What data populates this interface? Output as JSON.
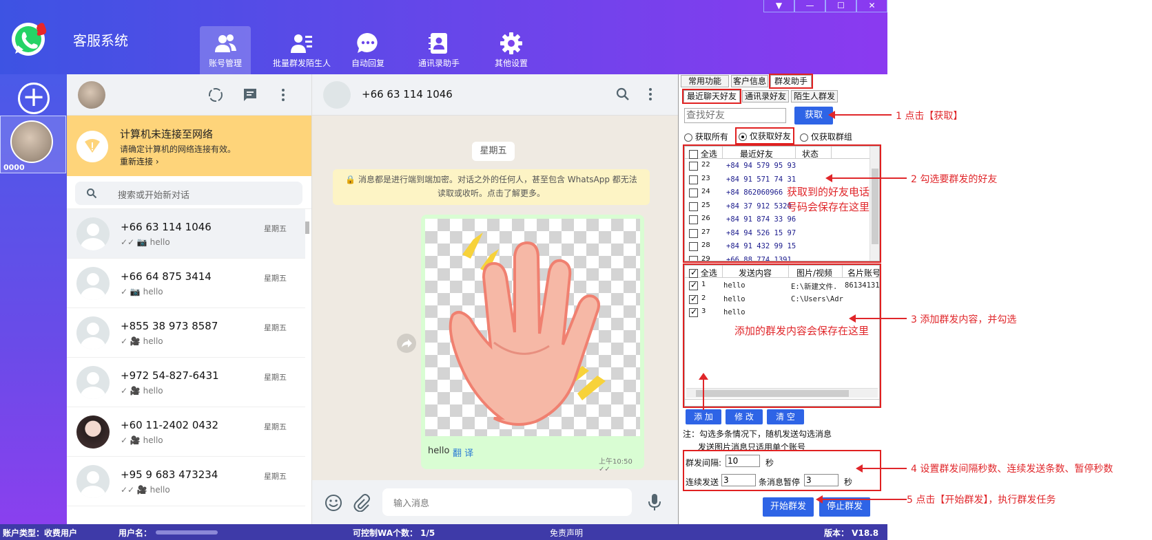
{
  "app": {
    "title": "客服系统"
  },
  "nav": [
    {
      "label": "账号管理",
      "icon": "users-icon"
    },
    {
      "label": "批量群发陌生人",
      "icon": "user-list-icon"
    },
    {
      "label": "自动回复",
      "icon": "chat-bubble-icon"
    },
    {
      "label": "通讯录助手",
      "icon": "contact-book-icon"
    },
    {
      "label": "其他设置",
      "icon": "gear-icon"
    }
  ],
  "window_controls": [
    "▼",
    "—",
    "☐",
    "✕"
  ],
  "account": {
    "label": "0000"
  },
  "network_warning": {
    "title": "计算机未连接至网络",
    "desc": "请确定计算机的网络连接有效。",
    "reconnect": "重新连接 ›"
  },
  "search": {
    "placeholder": "搜索或开始新对话"
  },
  "chats": [
    {
      "name": "+66 63 114 1046",
      "time": "星期五",
      "msg": "✓✓ 📷 hello"
    },
    {
      "name": "+66 64 875 3414",
      "time": "星期五",
      "msg": "✓ 📷 hello"
    },
    {
      "name": "+855 38 973 8587",
      "time": "星期五",
      "msg": "✓ 🎥 hello"
    },
    {
      "name": "+972 54-827-6431",
      "time": "星期五",
      "msg": "✓ 🎥 hello"
    },
    {
      "name": "+60 11-2402 0432",
      "time": "星期五",
      "msg": "✓ 🎥 hello"
    },
    {
      "name": "+95 9 683 473234",
      "time": "星期五",
      "msg": "✓✓ 🎥 hello"
    }
  ],
  "conversation": {
    "title": "+66 63 114 1046",
    "day": "星期五",
    "notice_line1": "🔒 消息都是进行端到端加密。对话之外的任何人，甚至包含 WhatsApp 都无法",
    "notice_line2": "读取或收听。点击了解更多。",
    "caption": "hello",
    "translate": "翻 译",
    "time": "上午10:50 ✓✓",
    "input_placeholder": "输入消息"
  },
  "right_panel": {
    "tabs": [
      "常用功能",
      "客户信息",
      "群发助手"
    ],
    "subtabs": [
      "最近聊天好友",
      "通讯录好友",
      "陌生人群发"
    ],
    "find_placeholder": "查找好友",
    "fetch_button": "获取",
    "radios": [
      "获取所有",
      "仅获取好友",
      "仅获取群组"
    ],
    "friend_headers": [
      "全选",
      "最近好友",
      "状态"
    ],
    "friends": [
      {
        "id": "22",
        "phone": "+84 94 579 95 93"
      },
      {
        "id": "23",
        "phone": "+84 91 571 74 31"
      },
      {
        "id": "24",
        "phone": "+84 862060966"
      },
      {
        "id": "25",
        "phone": "+84 37 912 5320"
      },
      {
        "id": "26",
        "phone": "+84 91 874 33 96"
      },
      {
        "id": "27",
        "phone": "+84 94 526 15 97"
      },
      {
        "id": "28",
        "phone": "+84 91 432 99 15"
      },
      {
        "id": "29",
        "phone": "+66 88 774 1391"
      }
    ],
    "content_headers": [
      "全选",
      "发送内容",
      "图片/视频",
      "名片账号"
    ],
    "contents": [
      {
        "id": "1",
        "text": "hello",
        "media": "E:\\新建文件.",
        "card": "86134131"
      },
      {
        "id": "2",
        "text": "hello",
        "media": "C:\\Users\\Adr",
        "card": ""
      },
      {
        "id": "3",
        "text": "hello",
        "media": "",
        "card": ""
      }
    ],
    "buttons": {
      "add": "添 加",
      "edit": "修 改",
      "clear": "清 空",
      "start": "开始群发",
      "stop": "停止群发"
    },
    "note_line1": "注：勾选多条情况下，随机发送勾选消息",
    "note_line2": "发送图片消息只适用单个账号",
    "interval_label": "群发间隔:",
    "interval_value": "10",
    "interval_unit": "秒",
    "continuous_label": "连续发送",
    "continuous_value": "3",
    "pause_label": "条消息暂停",
    "pause_value": "3",
    "pause_unit": "秒"
  },
  "overlays": {
    "friends_saved": [
      "获取到的好友电话",
      "号码会保存在这里"
    ],
    "contents_saved": "添加的群发内容会保存在这里"
  },
  "annotations": [
    "1 点击【获取】",
    "2 勾选要群发的好友",
    "3 添加群发内容，并勾选",
    "4 设置群发间隔秒数、连续发送条数、暂停秒数",
    "5 点击【开始群发】，执行群发任务"
  ],
  "statusbar": {
    "account_type": "账户类型：收费用户",
    "username": "用户名：",
    "controllable": "可控制WA个数：  1/5",
    "disclaimer": "免责声明",
    "version": "版本： V18.8"
  },
  "colors": {
    "brand_gradient_start": "#3d53e3",
    "brand_gradient_end": "#8b3af0",
    "annotation": "#e0262a",
    "button_blue": "#2e64e6"
  }
}
